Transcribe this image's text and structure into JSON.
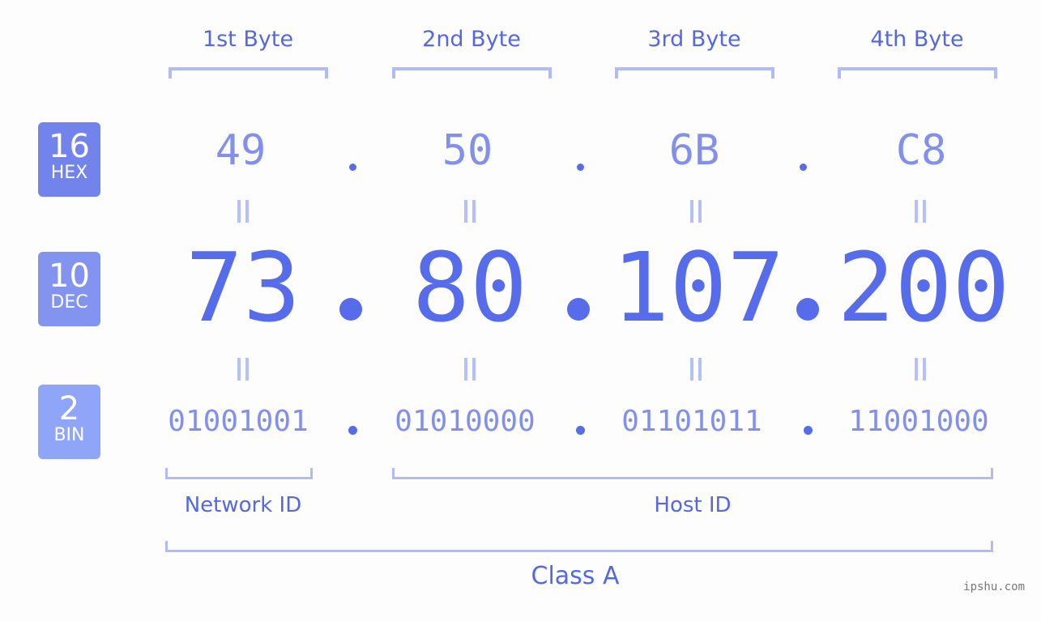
{
  "byte_headers": [
    "1st Byte",
    "2nd Byte",
    "3rd Byte",
    "4th Byte"
  ],
  "badges": [
    {
      "num": "16",
      "label": "HEX",
      "color": "#7383ec"
    },
    {
      "num": "10",
      "label": "DEC",
      "color": "#8294f0"
    },
    {
      "num": "2",
      "label": "BIN",
      "color": "#8fa6f8"
    }
  ],
  "hex_values": [
    "49",
    "50",
    "6B",
    "C8"
  ],
  "dec_values": [
    "73",
    "80",
    "107",
    "200"
  ],
  "bin_values": [
    "01001001",
    "01010000",
    "01101011",
    "11001000"
  ],
  "network_id_label": "Network ID",
  "host_id_label": "Host ID",
  "class_label": "Class A",
  "watermark": "ipshu.com",
  "colors": {
    "accent": "#566ceb",
    "light_accent": "#8190ec",
    "bracket": "#b1bcf7",
    "background": "#fcfdfc"
  }
}
